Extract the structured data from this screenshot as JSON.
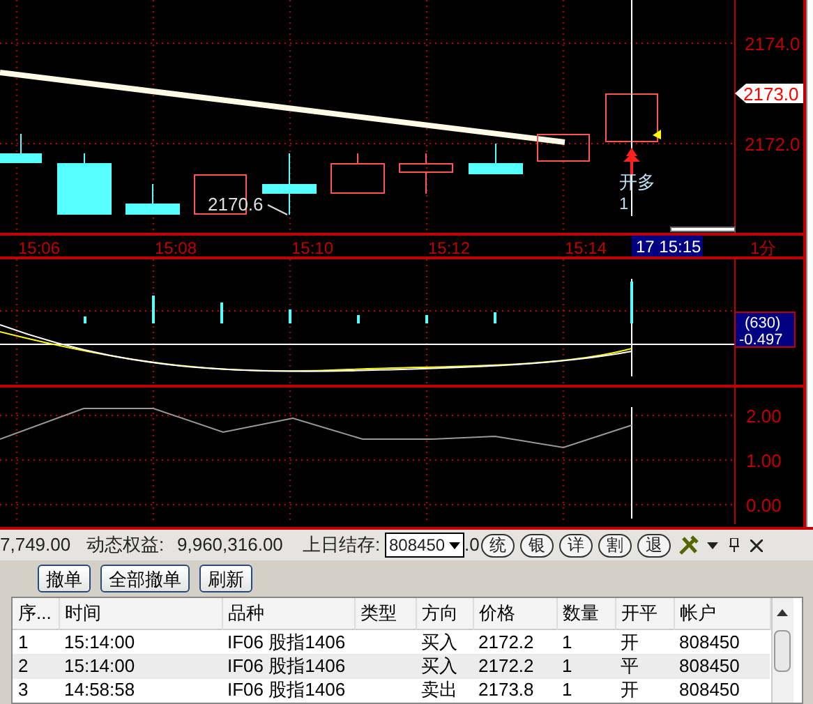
{
  "chart": {
    "price_axis": [
      {
        "label": "2174.0",
        "current": false
      },
      {
        "label": "2173.0",
        "current": true
      },
      {
        "label": "2172.0",
        "current": false
      }
    ],
    "time_axis": [
      "15:06",
      "15:08",
      "15:10",
      "15:12",
      "15:14"
    ],
    "cursor_time": "17 15:15",
    "period": "1分",
    "low_annotation": "2170.6",
    "trade_marker": {
      "label": "开多",
      "quantity": "1"
    },
    "indicator_readout": [
      "(630)",
      "-0.497"
    ],
    "oscillator_axis": [
      "2.00",
      "1.00",
      "0.00"
    ]
  },
  "account_bar": {
    "balance_tail": "7,749.00",
    "equity_label": "动态权益:",
    "equity": "9,960,316.00",
    "prev_label": "上日结存:",
    "account": "808450",
    "prev_tail": ".0",
    "buttons": [
      "统",
      "银",
      "详",
      "割",
      "退"
    ]
  },
  "order_buttons": [
    "撤单",
    "全部撤单",
    "刷新"
  ],
  "table": {
    "columns": [
      "序...",
      "时间",
      "品种",
      "类型",
      "方向",
      "价格",
      "数量",
      "开平",
      "帐户"
    ],
    "rows": [
      [
        "1",
        "15:14:00",
        "IF06 股指1406",
        "",
        "买入",
        "2172.2",
        "1",
        "开",
        "808450"
      ],
      [
        "2",
        "15:14:00",
        "IF06 股指1406",
        "",
        "买入",
        "2172.2",
        "1",
        "平",
        "808450"
      ],
      [
        "3",
        "14:58:58",
        "IF06 股指1406",
        "",
        "卖出",
        "2173.8",
        "1",
        "开",
        "808450"
      ]
    ]
  }
}
